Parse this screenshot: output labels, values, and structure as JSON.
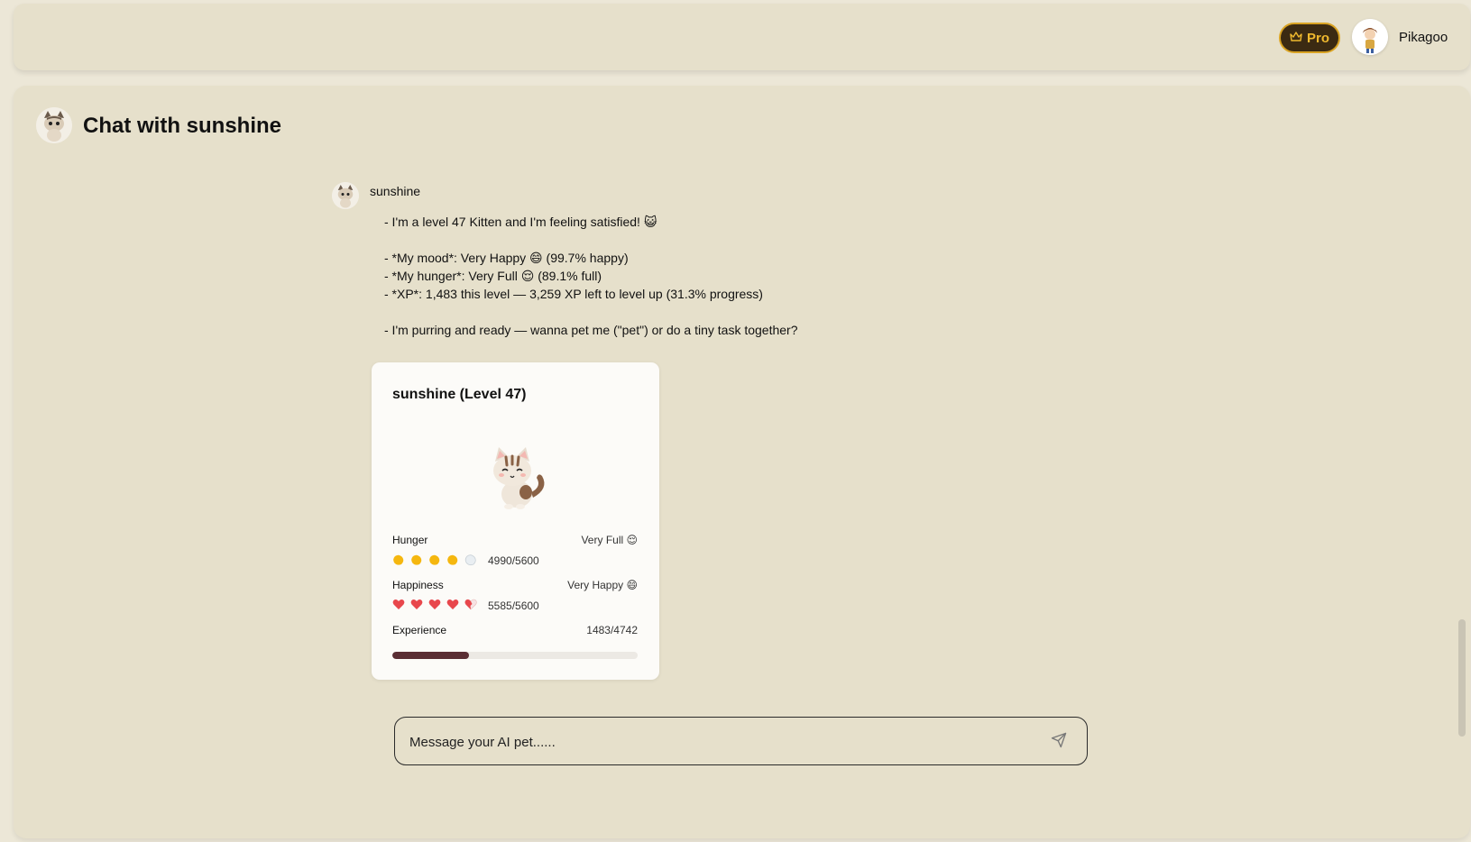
{
  "header": {
    "pro_label": "Pro",
    "username": "Pikagoo"
  },
  "chat": {
    "title": "Chat with sunshine",
    "message": {
      "sender": "sunshine",
      "lines": [
        "- I'm a level 47 Kitten and I'm feeling satisfied! 😺",
        "- *My mood*: Very Happy 😄 (99.7% happy)",
        "- *My hunger*: Very Full 😌 (89.1% full)",
        "- *XP*: 1,483 this level — 3,259 XP left to level up (31.3% progress)",
        "- I'm purring and ready — wanna pet me (\"pet\") or do a tiny task together?"
      ]
    },
    "input_placeholder": "Message your AI pet......"
  },
  "pet_card": {
    "title": "sunshine (Level 47)",
    "hunger": {
      "label": "Hunger",
      "status": "Very Full 😌",
      "value": "4990/5600",
      "icons_filled": 4,
      "icons_total": 5
    },
    "happiness": {
      "label": "Happiness",
      "status": "Very Happy 😄",
      "value": "5585/5600",
      "hearts_full": 4,
      "hearts_total": 5
    },
    "experience": {
      "label": "Experience",
      "value": "1483/4742",
      "progress_fraction": 0.313
    }
  },
  "colors": {
    "pro_bg": "#3b2a12",
    "pro_accent": "#f0b92e",
    "xp_fill": "#5a2e34",
    "heart": "#e8474c",
    "hunger_icon": "#f5b70f"
  }
}
